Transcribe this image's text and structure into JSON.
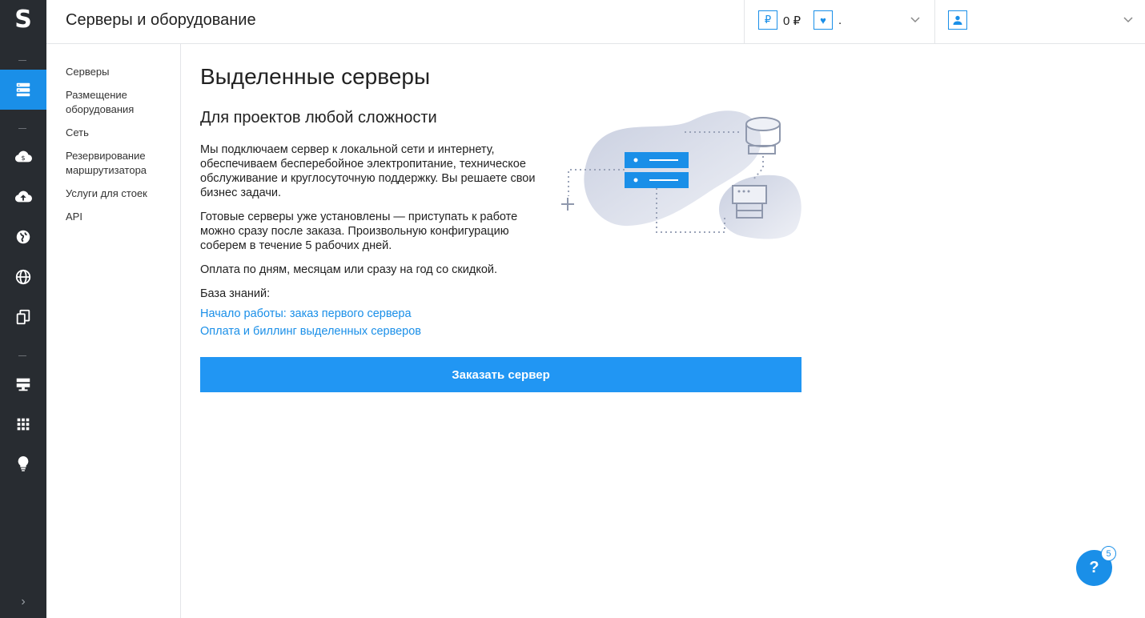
{
  "app": {
    "logo_letter": "S",
    "page_title": "Серверы и оборудование",
    "accent_color": "#1a8fe8"
  },
  "rail": {
    "icons": [
      {
        "name": "dedicated-servers-icon",
        "active": true
      },
      {
        "name": "cloud-money-icon",
        "active": false
      },
      {
        "name": "cloud-upload-icon",
        "active": false
      },
      {
        "name": "globe-icon",
        "active": false
      },
      {
        "name": "network-globe-icon",
        "active": false
      },
      {
        "name": "copy-devices-icon",
        "active": false
      },
      {
        "name": "rack-servers-icon",
        "active": false
      },
      {
        "name": "apps-grid-icon",
        "active": false
      },
      {
        "name": "lightbulb-icon",
        "active": false
      }
    ],
    "expand_icon": "chevron-right-icon"
  },
  "header": {
    "balance": {
      "currency_symbol": "₽",
      "value": "0 ₽"
    },
    "bonus": {
      "symbol": "♥",
      "value": "."
    }
  },
  "subnav": {
    "items": [
      {
        "label": "Серверы"
      },
      {
        "label": "Размещение оборудования"
      },
      {
        "label": "Сеть"
      },
      {
        "label": "Резервирование маршрутизатора"
      },
      {
        "label": "Услуги для стоек"
      },
      {
        "label": "API"
      }
    ]
  },
  "main": {
    "title": "Выделенные серверы",
    "subtitle": "Для проектов любой сложности",
    "paragraphs": [
      "Мы подключаем сервер к локальной сети и интернету, обеспечиваем бесперебойное электропитание, техническое обслуживание и круглосуточную поддержку. Вы решаете свои бизнес задачи.",
      "Готовые серверы уже установлены — приступать к работе можно сразу после заказа. Произвольную конфигурацию соберем в течение 5 рабочих дней.",
      "Оплата по дням, месяцам или сразу на год со скидкой."
    ],
    "kb_label": "База знаний:",
    "links": [
      "Начало работы: заказ первого сервера",
      "Оплата и биллинг выделенных серверов"
    ],
    "order_button": "Заказать сервер"
  },
  "help": {
    "label": "?",
    "badge": "5"
  }
}
